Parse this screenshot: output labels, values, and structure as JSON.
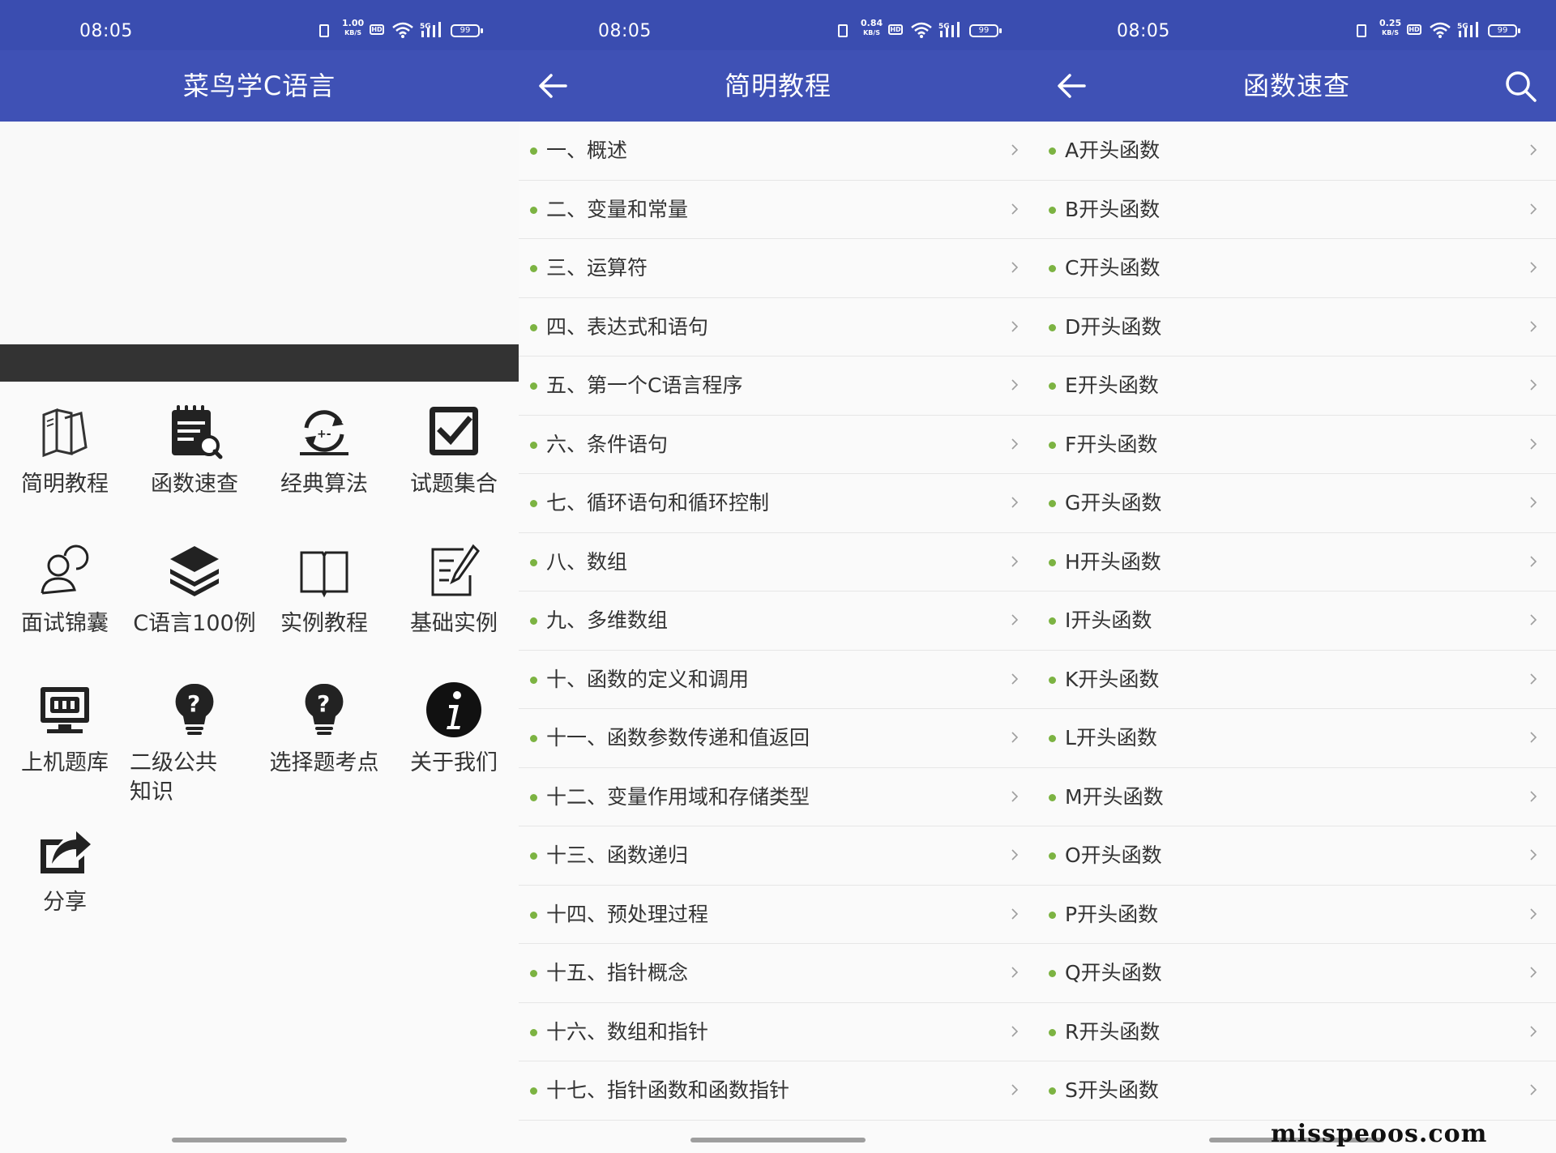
{
  "status": {
    "time": "08:05",
    "battery": "99",
    "network": "5G",
    "hd": "HD",
    "speeds": [
      "1.00",
      "0.84",
      "0.25"
    ],
    "speed_unit": "KB/S"
  },
  "home": {
    "title": "菜鸟学C语言",
    "grid": [
      {
        "label": "简明教程",
        "icon": "books-icon"
      },
      {
        "label": "函数速查",
        "icon": "notepad-search-icon"
      },
      {
        "label": "经典算法",
        "icon": "refresh-calc-icon"
      },
      {
        "label": "试题集合",
        "icon": "checkbox-icon"
      },
      {
        "label": "面试锦囊",
        "icon": "user-chat-icon"
      },
      {
        "label": "C语言100例",
        "icon": "layers-icon"
      },
      {
        "label": "实例教程",
        "icon": "open-book-icon"
      },
      {
        "label": "基础实例",
        "icon": "edit-note-icon"
      },
      {
        "label": "上机题库",
        "icon": "monitor-icon"
      },
      {
        "label": "二级公共知识",
        "icon": "help-bulb-icon"
      },
      {
        "label": "选择题考点",
        "icon": "help-bulb-icon"
      },
      {
        "label": "关于我们",
        "icon": "info-icon"
      },
      {
        "label": "分享",
        "icon": "share-icon"
      }
    ]
  },
  "tutorial": {
    "title": "简明教程",
    "items": [
      "一、概述",
      "二、变量和常量",
      "三、运算符",
      "四、表达式和语句",
      "五、第一个C语言程序",
      "六、条件语句",
      "七、循环语句和循环控制",
      "八、数组",
      "九、多维数组",
      "十、函数的定义和调用",
      "十一、函数参数传递和值返回",
      "十二、变量作用域和存储类型",
      "十三、函数递归",
      "十四、预处理过程",
      "十五、指针概念",
      "十六、数组和指针",
      "十七、指针函数和函数指针"
    ]
  },
  "functions": {
    "title": "函数速查",
    "items": [
      "A开头函数",
      "B开头函数",
      "C开头函数",
      "D开头函数",
      "E开头函数",
      "F开头函数",
      "G开头函数",
      "H开头函数",
      "I开头函数",
      "K开头函数",
      "L开头函数",
      "M开头函数",
      "O开头函数",
      "P开头函数",
      "Q开头函数",
      "R开头函数",
      "S开头函数"
    ]
  },
  "watermark": "misspeoos.com",
  "colors": {
    "statusbar": "#3a4db0",
    "appbar": "#3f51b5",
    "dot": "#7cb342",
    "banner_bar": "#333333"
  }
}
